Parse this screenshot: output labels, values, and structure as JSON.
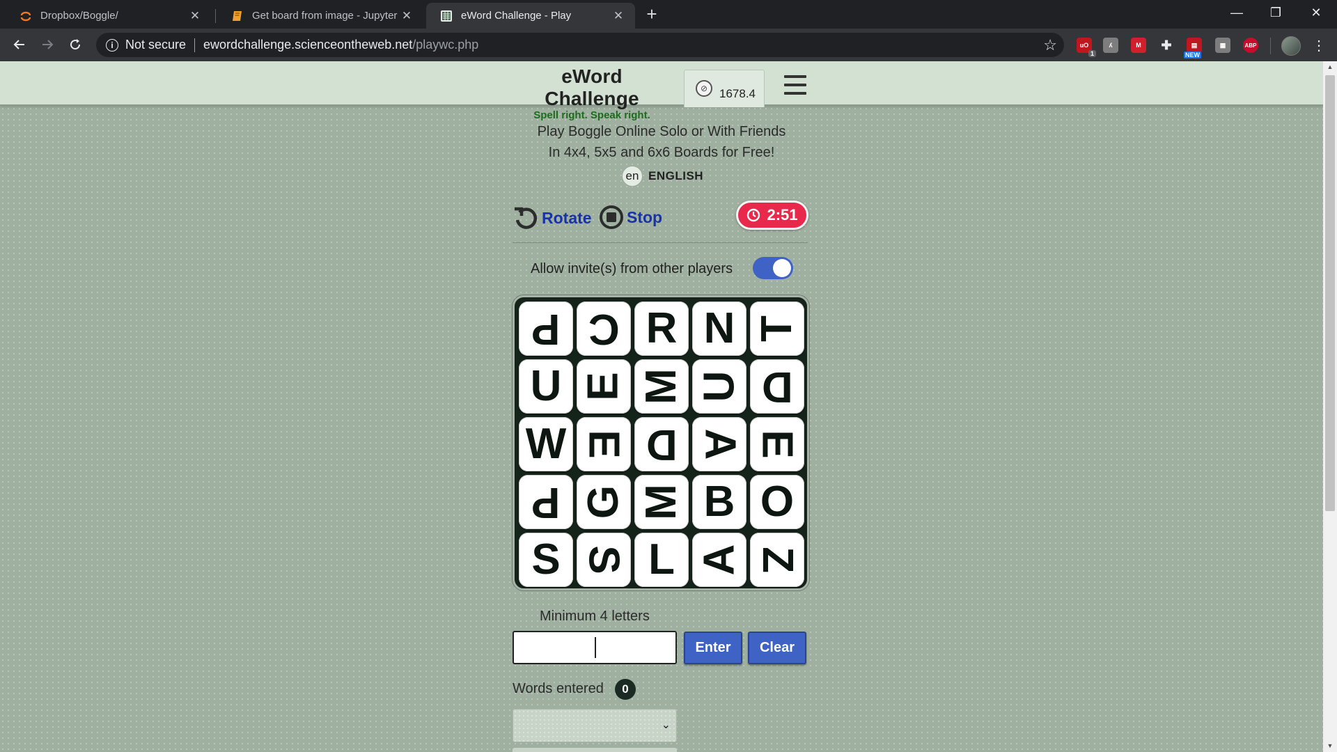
{
  "browser": {
    "tabs": [
      {
        "title": "Dropbox/Boggle/",
        "active": false
      },
      {
        "title": "Get board from image - Jupyter Notebook",
        "active": false
      },
      {
        "title": "eWord Challenge - Play",
        "active": true
      }
    ],
    "new_tab": "+",
    "window_controls": {
      "minimize": "—",
      "maximize": "❐",
      "close": "✕"
    },
    "address": {
      "security_label": "Not secure",
      "host": "ewordchallenge.scienceontheweb.net",
      "path": "/playwc.php"
    },
    "extensions": [
      {
        "name": "ublock-icon",
        "label": "uO",
        "badge": "1",
        "color": "#c0161f"
      },
      {
        "name": "extension-icon",
        "label": "ʎ",
        "color": "#7d7d7d"
      },
      {
        "name": "extension-icon",
        "label": "M",
        "color": "#d0202e"
      },
      {
        "name": "extension-icon",
        "label": "✚",
        "color": "#35363a"
      },
      {
        "name": "extension-icon",
        "label": "▤",
        "badge_new": "NEW",
        "color": "#c0161f"
      },
      {
        "name": "extension-icon",
        "label": "▦",
        "color": "#7d7d7d"
      },
      {
        "name": "adblock-icon",
        "label": "ABP",
        "color": "#c70d2c"
      }
    ]
  },
  "site": {
    "title": "eWord Challenge",
    "tagline": "Spell right. Speak right.",
    "rating": "1678.4",
    "intro_line1": "Play Boggle Online Solo or With Friends",
    "intro_line2": "In 4x4, 5x5 and 6x6 Boards for Free!",
    "language_code": "en",
    "language_name": "ENGLISH"
  },
  "game": {
    "rotate_label": "Rotate",
    "stop_label": "Stop",
    "timer": "2:51",
    "invite_label": "Allow invite(s) from other players",
    "invite_enabled": true,
    "board": [
      [
        {
          "letter": "P",
          "rotation": 180
        },
        {
          "letter": "C",
          "rotation": 180
        },
        {
          "letter": "R",
          "rotation": 0
        },
        {
          "letter": "N",
          "rotation": 0
        },
        {
          "letter": "T",
          "rotation": 270
        }
      ],
      [
        {
          "letter": "U",
          "rotation": 0
        },
        {
          "letter": "E",
          "rotation": 270
        },
        {
          "letter": "M",
          "rotation": 270
        },
        {
          "letter": "U",
          "rotation": 270
        },
        {
          "letter": "D",
          "rotation": 180
        }
      ],
      [
        {
          "letter": "W",
          "rotation": 0
        },
        {
          "letter": "E",
          "rotation": 90
        },
        {
          "letter": "D",
          "rotation": 180
        },
        {
          "letter": "A",
          "rotation": 90
        },
        {
          "letter": "E",
          "rotation": 90
        }
      ],
      [
        {
          "letter": "P",
          "rotation": 180
        },
        {
          "letter": "G",
          "rotation": 270
        },
        {
          "letter": "M",
          "rotation": 270
        },
        {
          "letter": "B",
          "rotation": 0
        },
        {
          "letter": "O",
          "rotation": 0
        }
      ],
      [
        {
          "letter": "S",
          "rotation": 0
        },
        {
          "letter": "S",
          "rotation": 90
        },
        {
          "letter": "L",
          "rotation": 0
        },
        {
          "letter": "A",
          "rotation": 270
        },
        {
          "letter": "Z",
          "rotation": 90
        }
      ]
    ],
    "min_letters_label": "Minimum 4 letters",
    "input_value": "",
    "enter_label": "Enter",
    "clear_label": "Clear",
    "words_label": "Words entered",
    "words_count": "0"
  }
}
